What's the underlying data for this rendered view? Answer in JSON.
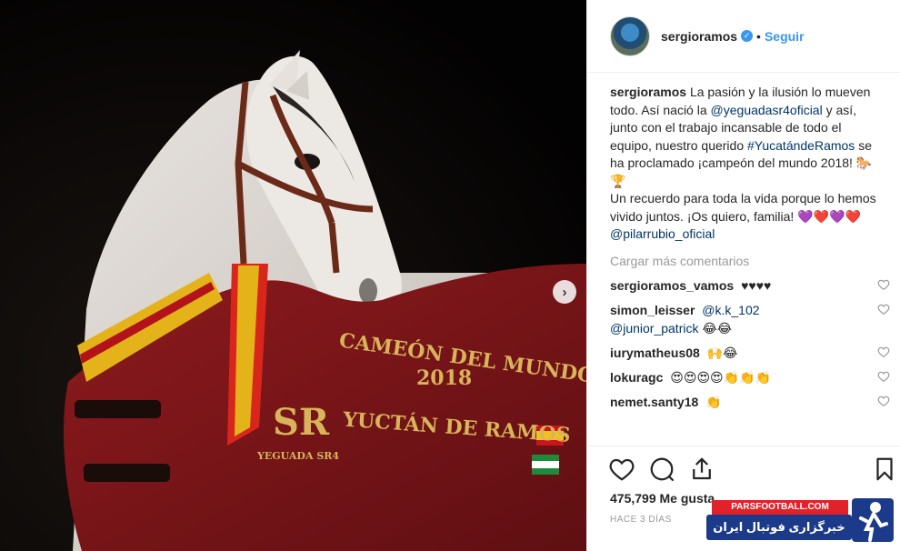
{
  "photo": {
    "blanket_text_1": "CAMEÓN DEL MUNDO",
    "blanket_text_2": "2018",
    "blanket_text_3": "YUCTÁN DE RAMOS",
    "brand_initials": "SR",
    "brand_name": "YEGUADA SR4",
    "next_icon": "chevron-right-icon"
  },
  "header": {
    "username": "sergioramos",
    "verified_icon": "verified-badge-icon",
    "separator": "•",
    "follow_label": "Seguir"
  },
  "caption": {
    "username": "sergioramos",
    "text_1": "La pasión y la ilusión lo mueven todo. Así nació la",
    "mention_1": "@yeguadasr4oficial",
    "text_2": "y así, junto con el trabajo incansable de todo el equipo, nuestro querido",
    "hashtag": "#YucatándeRamos",
    "text_3": "se ha proclamado ¡campeón del mundo 2018! 🐎🏆",
    "text_4": "Un recuerdo para toda la vida porque lo hemos vivido juntos. ¡Os quiero, familia! 💜❤️💜❤️",
    "mention_2": "@pilarrubio_oficial"
  },
  "load_more": "Cargar más comentarios",
  "comments": [
    {
      "user": "sergioramos_vamos",
      "text": "♥♥♥♥"
    },
    {
      "user": "simon_leisser",
      "mention": "@k.k_102",
      "mention2": "@junior_patrick",
      "text": "😂😂"
    },
    {
      "user": "iurymatheus08",
      "text": "🙌😂"
    },
    {
      "user": "lokuragc",
      "text": "😍😍😍😍👏👏👏"
    },
    {
      "user": "nemet.santy18",
      "text": "👏"
    }
  ],
  "actions": {
    "like_icon": "heart-icon",
    "comment_icon": "comment-icon",
    "share_icon": "share-icon",
    "save_icon": "bookmark-icon"
  },
  "likes": "475,799 Me gusta",
  "time": "HACE 3 DÍAS",
  "watermark": {
    "top": "PARSFOOTBALL.COM",
    "bottom": "خبرگزاری فوتبال ایران"
  },
  "colors": {
    "link": "#003569",
    "accent": "#3897f0",
    "blanket": "#7d1418"
  }
}
